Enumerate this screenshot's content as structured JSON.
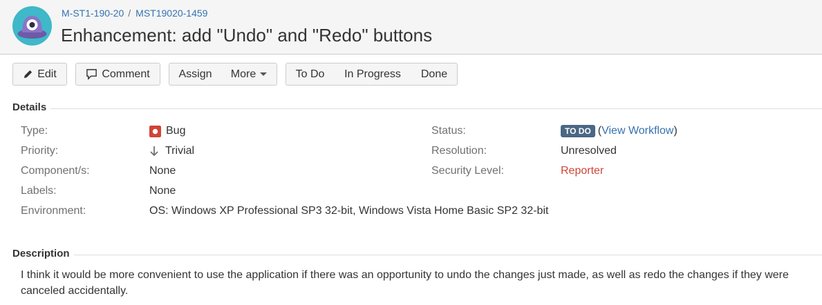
{
  "breadcrumbs": {
    "project": "M-ST1-190-20",
    "separator": "/",
    "issue_key": "MST19020-1459"
  },
  "title": "Enhancement: add \"Undo\" and \"Redo\" buttons",
  "toolbar": {
    "edit": "Edit",
    "comment": "Comment",
    "assign": "Assign",
    "more": "More",
    "todo": "To Do",
    "in_progress": "In Progress",
    "done": "Done"
  },
  "details": {
    "heading": "Details",
    "type_label": "Type:",
    "type_value": "Bug",
    "priority_label": "Priority:",
    "priority_value": "Trivial",
    "components_label": "Component/s:",
    "components_value": "None",
    "labels_label": "Labels:",
    "labels_value": "None",
    "environment_label": "Environment:",
    "environment_value": "OS: Windows XP Professional SP3 32-bit, Windows Vista Home Basic SP2 32-bit",
    "status_label": "Status:",
    "status_value": "TO DO",
    "view_workflow": "View Workflow",
    "resolution_label": "Resolution:",
    "resolution_value": "Unresolved",
    "security_label": "Security Level:",
    "security_value": "Reporter"
  },
  "description": {
    "heading": "Description",
    "text": "I think it would be more convenient to use the application if there was an opportunity to undo the changes just made, as well as redo the changes if they were canceled accidentally."
  },
  "colors": {
    "link": "#3572b0",
    "status_lozenge": "#4a6785",
    "bug": "#d04437",
    "header_bg": "#f5f5f5"
  },
  "icons": {
    "avatar": "project-avatar-icon",
    "edit": "pencil-icon",
    "comment": "comment-icon",
    "type": "bug-icon",
    "priority": "arrow-down-icon",
    "more": "caret-down-icon"
  }
}
